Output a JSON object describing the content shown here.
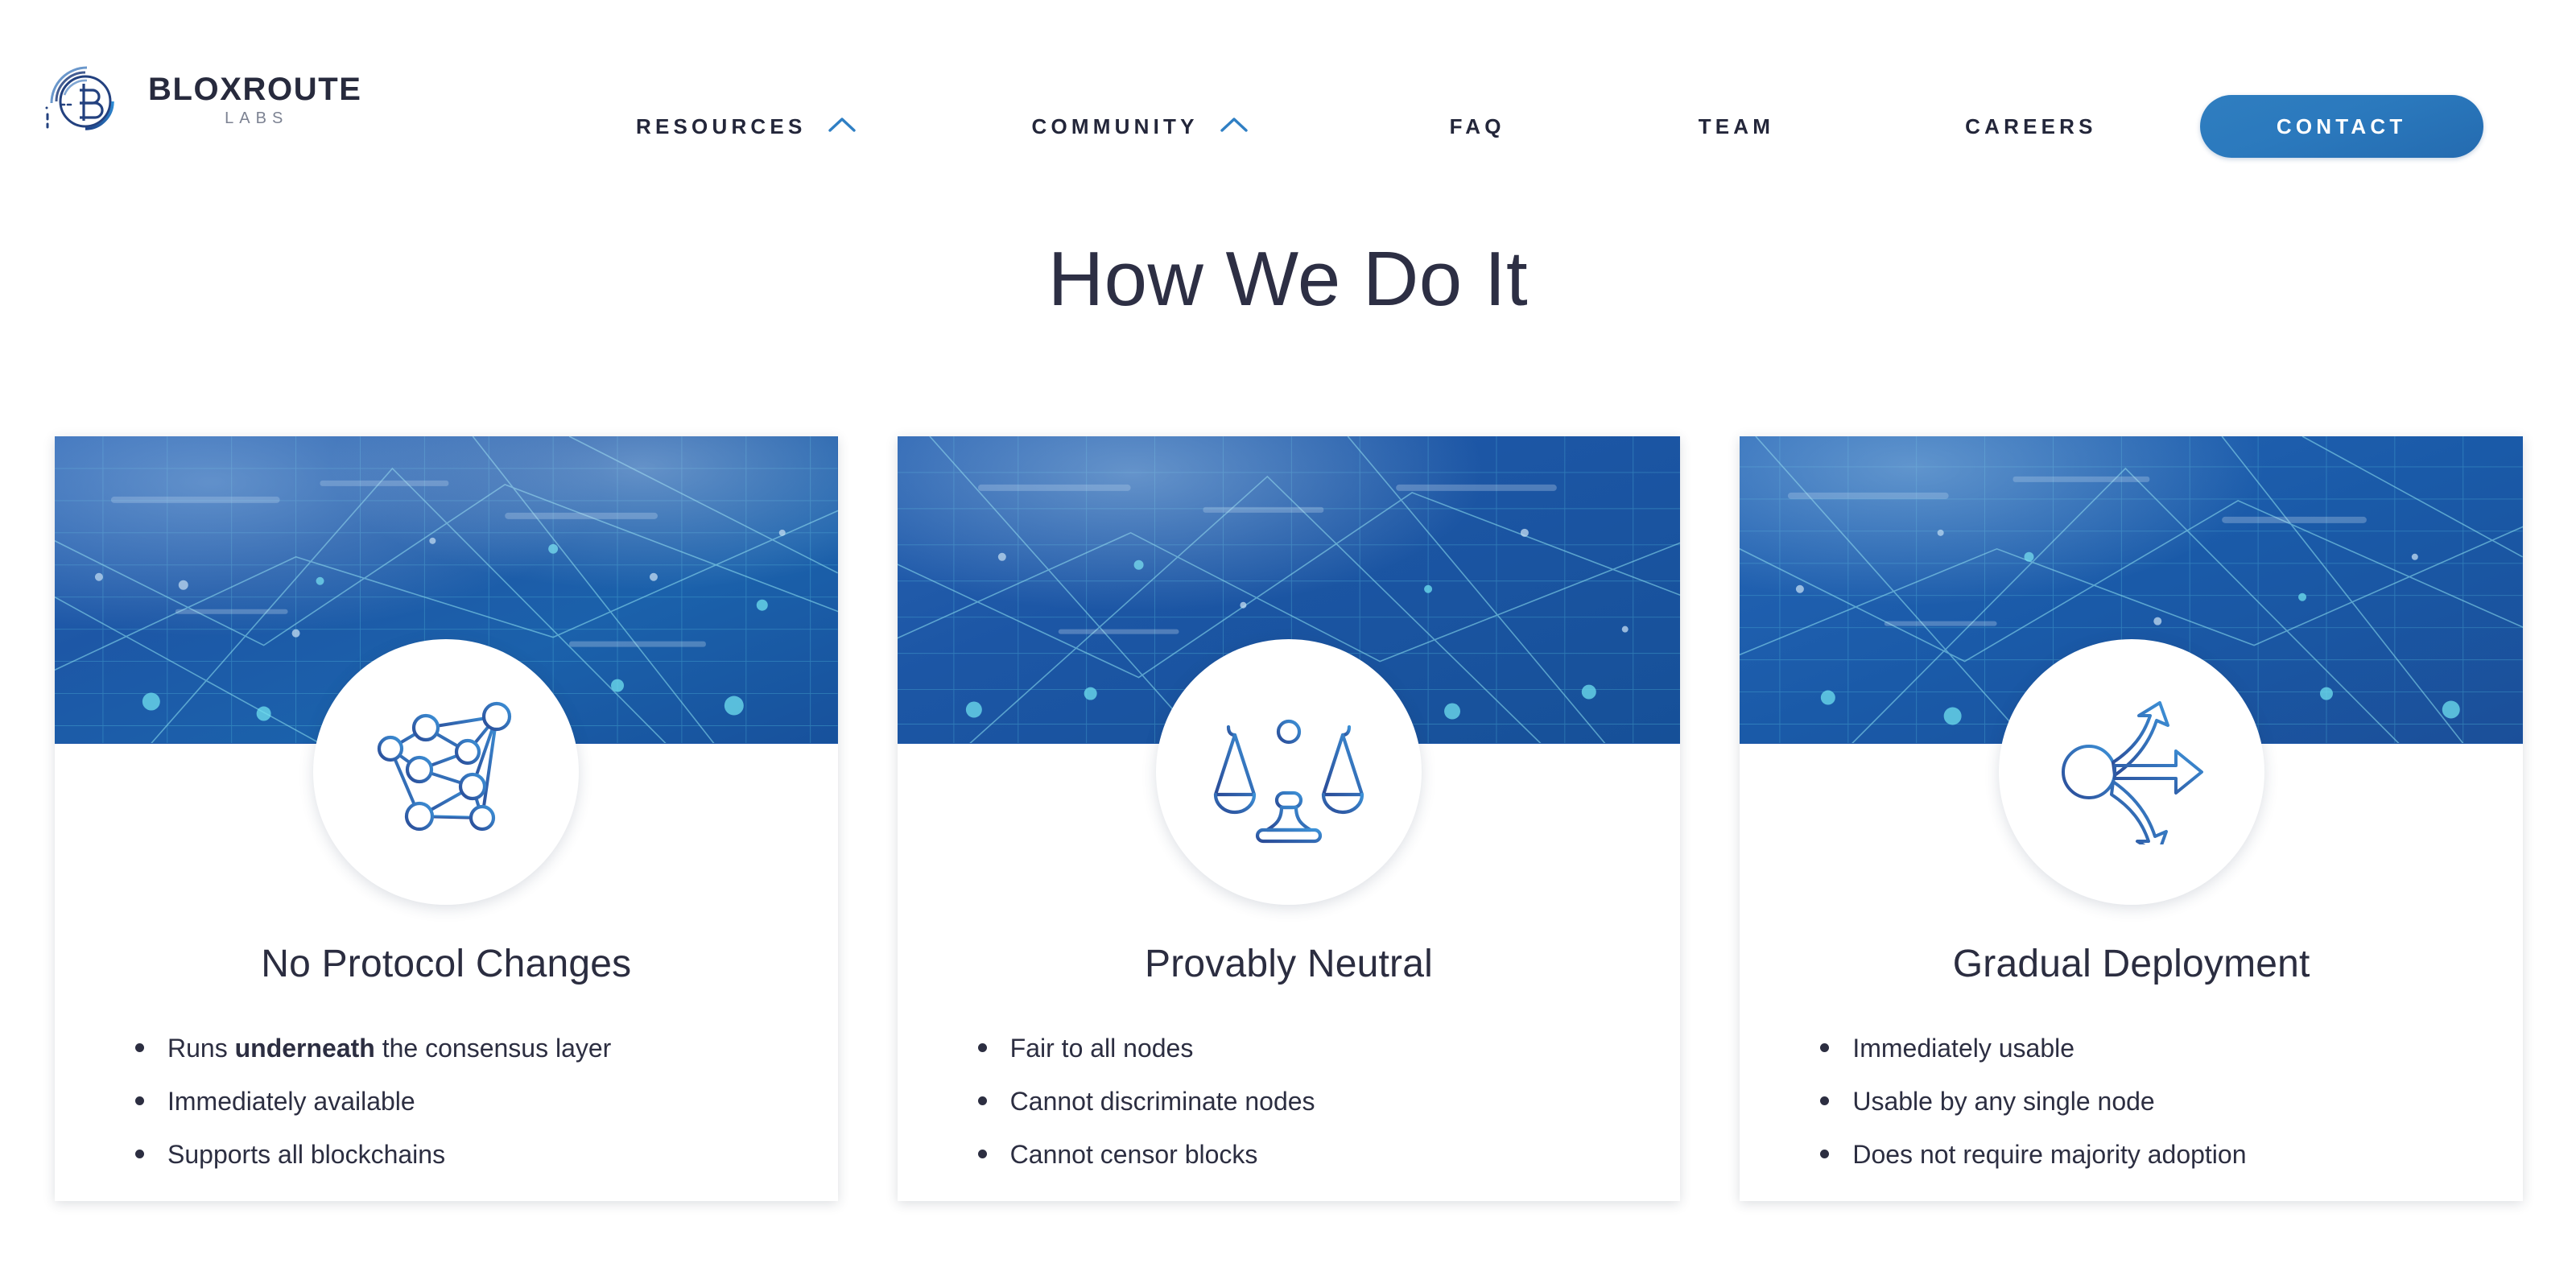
{
  "header": {
    "logo": {
      "mark_icon": "bloxroute-circular-b-logo-icon",
      "word": "BLOXROUTE",
      "sub": "LABS"
    },
    "nav": [
      {
        "label": "RESOURCES",
        "has_chevron": true,
        "chevron_icon": "chevron-up-icon"
      },
      {
        "label": "COMMUNITY",
        "has_chevron": true,
        "chevron_icon": "chevron-up-icon"
      },
      {
        "label": "FAQ",
        "has_chevron": false
      },
      {
        "label": "TEAM",
        "has_chevron": false
      },
      {
        "label": "CAREERS",
        "has_chevron": false
      }
    ],
    "contact_label": "CONTACT"
  },
  "main": {
    "title": "How We Do It",
    "cards": [
      {
        "title": "No Protocol Changes",
        "icon": "network-mesh-icon",
        "bullets": [
          {
            "before": "Runs ",
            "bold": "underneath",
            "after": " the consensus layer"
          },
          {
            "before": "Immediately available",
            "bold": "",
            "after": ""
          },
          {
            "before": "Supports all blockchains",
            "bold": "",
            "after": ""
          }
        ]
      },
      {
        "title": "Provably Neutral",
        "icon": "balance-scales-icon",
        "bullets": [
          {
            "before": "Fair to all nodes",
            "bold": "",
            "after": ""
          },
          {
            "before": "Cannot discriminate nodes",
            "bold": "",
            "after": ""
          },
          {
            "before": "Cannot censor blocks",
            "bold": "",
            "after": ""
          }
        ]
      },
      {
        "title": "Gradual Deployment",
        "icon": "branching-arrows-icon",
        "bullets": [
          {
            "before": "Immediately usable",
            "bold": "",
            "after": ""
          },
          {
            "before": "Usable by any single node",
            "bold": "",
            "after": ""
          },
          {
            "before": "Does not require majority adoption",
            "bold": "",
            "after": ""
          }
        ]
      }
    ]
  },
  "colors": {
    "accent_blue": "#2f7fc4",
    "contact_button": "#2b79bd",
    "text_dark": "#2b2d40",
    "logo_word": "#272a3d",
    "logo_sub": "#7c8292",
    "card_media_blue": "#1e58a8"
  }
}
